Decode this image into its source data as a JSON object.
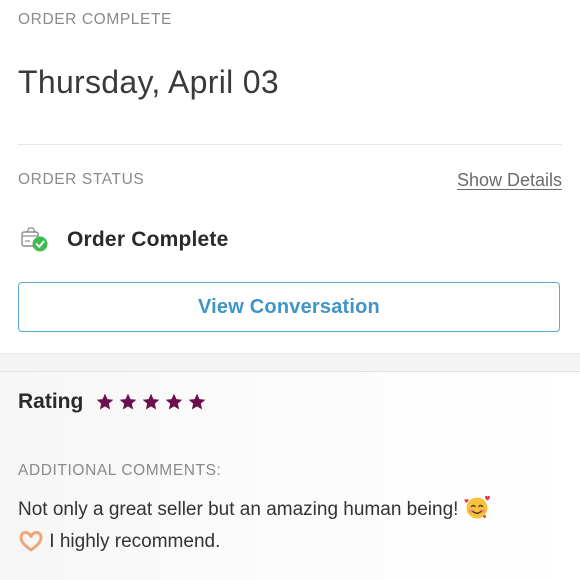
{
  "order": {
    "section_label": "ORDER COMPLETE",
    "date": "Thursday, April 03"
  },
  "status": {
    "section_label": "ORDER STATUS",
    "show_details_label": "Show Details",
    "text": "Order Complete",
    "icon": "package-check-icon",
    "check_color": "#3fb950"
  },
  "actions": {
    "view_conversation_label": "View Conversation",
    "accent_color": "#3f95c8"
  },
  "rating": {
    "label": "Rating",
    "stars": 5,
    "max_stars": 5,
    "star_color": "#6e0f4d"
  },
  "comments": {
    "section_label": "ADDITIONAL COMMENTS:",
    "text_part1": "Not only a great seller but an amazing human being! ",
    "text_part2": " I highly recommend.",
    "emoji_1": "smiling-face-with-hearts",
    "emoji_2": "heart-hands"
  }
}
